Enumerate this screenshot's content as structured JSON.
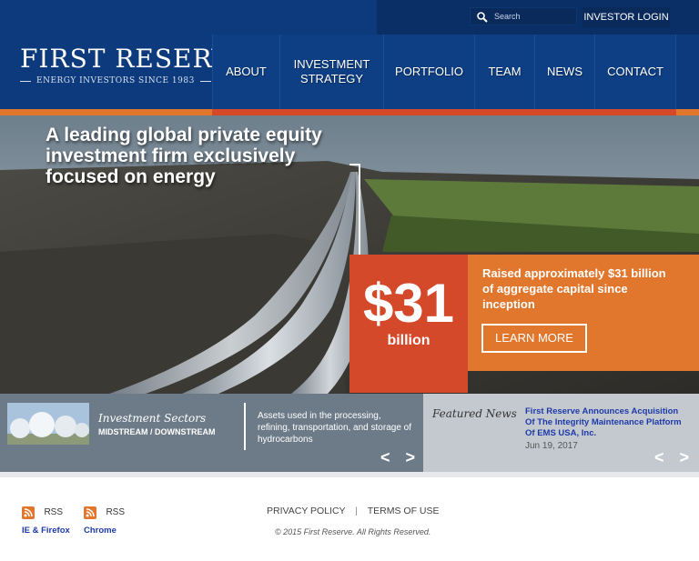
{
  "header": {
    "search_placeholder": "Search",
    "login_label": "INVESTOR LOGIN",
    "logo_title": "FIRST RESERVE",
    "logo_subtitle": "ENERGY INVESTORS SINCE 1983"
  },
  "nav": [
    {
      "label": "ABOUT"
    },
    {
      "label": "INVESTMENT STRATEGY"
    },
    {
      "label": "PORTFOLIO"
    },
    {
      "label": "TEAM"
    },
    {
      "label": "NEWS"
    },
    {
      "label": "CONTACT"
    }
  ],
  "hero": {
    "headline": "A leading global private equity investment firm exclusively focused on energy",
    "stat_value": "$31",
    "stat_unit": "billion",
    "stat_description": "Raised approximately $31 billion of aggregate capital since inception",
    "cta_label": "LEARN MORE"
  },
  "sectors": {
    "title": "Investment Sectors",
    "name": "MIDSTREAM / DOWNSTREAM",
    "description": "Assets used in the processing, refining, transportation, and storage of hydrocarbons",
    "prev": "<",
    "next": ">"
  },
  "featured_news": {
    "title": "Featured News",
    "headline": "First Reserve Announces Acquisition Of The Integrity Maintenance Platform Of EMS USA, Inc.",
    "date": "Jun 19, 2017",
    "prev": "<",
    "next": ">"
  },
  "footer": {
    "rss1_label": "RSS",
    "rss1_sub": "IE & Firefox",
    "rss2_label": "RSS",
    "rss2_sub": "Chrome",
    "privacy": "PRIVACY POLICY",
    "separator": "|",
    "terms": "TERMS OF USE",
    "copyright": "© 2015 First Reserve. All Rights Reserved."
  },
  "colors": {
    "brand_blue": "#0c3a7c",
    "accent_orange": "#e1762d",
    "accent_red": "#d4492a",
    "link_blue": "#1d3aa8"
  }
}
